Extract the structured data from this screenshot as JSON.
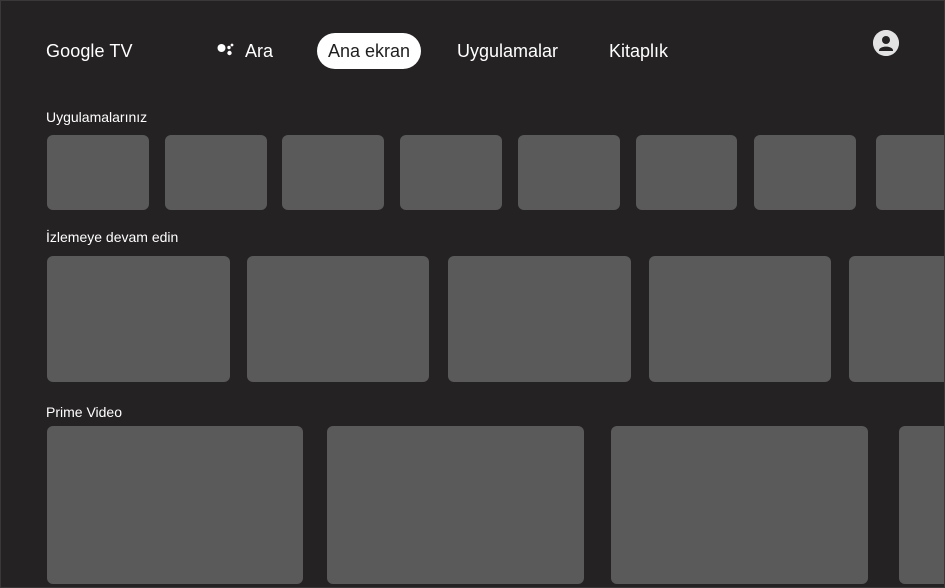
{
  "header": {
    "brand": "Google TV",
    "nav": {
      "search_label": "Ara",
      "home_label": "Ana ekran",
      "apps_label": "Uygulamalar",
      "library_label": "Kitaplık"
    },
    "selected_tab": "Ana ekran",
    "avatar_icon": "account-circle-icon",
    "assistant_icon": "google-assistant-icon"
  },
  "rows": {
    "apps": {
      "title": "Uygulamalarınız",
      "tile_count": 8
    },
    "continue_watching": {
      "title": "İzlemeye devam edin",
      "tile_count": 5
    },
    "prime_video": {
      "title": "Prime Video",
      "tile_count": 4
    }
  },
  "colors": {
    "background": "#242222",
    "tile": "#5a5a5a",
    "selected_pill": "#ffffff",
    "text": "#ffffff"
  }
}
